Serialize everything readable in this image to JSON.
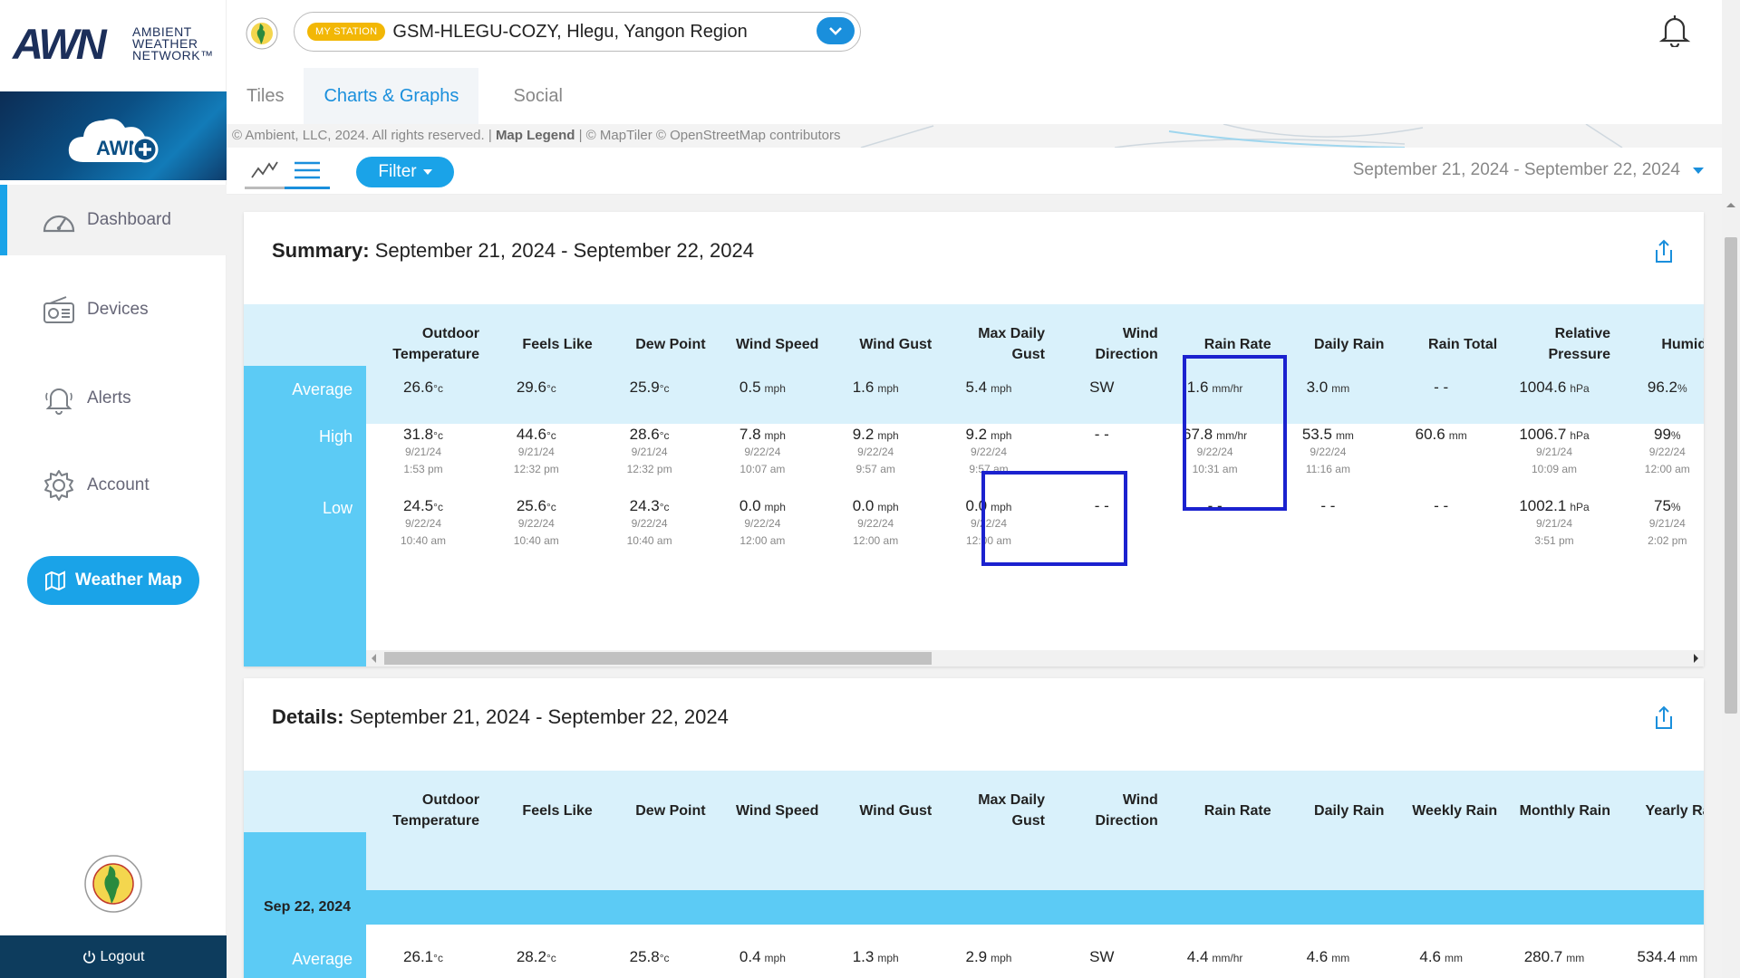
{
  "brand": {
    "mark": "AWN",
    "line1": "AMBIENT",
    "line2": "WEATHER",
    "line3": "NETWORK™"
  },
  "sidebar": {
    "items": [
      {
        "label": "Dashboard",
        "icon": "gauge-icon",
        "active": true
      },
      {
        "label": "Devices",
        "icon": "radio-icon"
      },
      {
        "label": "Alerts",
        "icon": "bell-icon"
      },
      {
        "label": "Account",
        "icon": "gear-icon"
      }
    ],
    "weather_map": "Weather Map",
    "logout": "Logout"
  },
  "station": {
    "badge": "MY STATION",
    "name": "GSM-HLEGU-COZY, Hlegu, Yangon Region"
  },
  "tabs": [
    "Tiles",
    "Charts & Graphs",
    "Social"
  ],
  "map_credit": {
    "prefix": "© Ambient, LLC, 2024. All rights reserved. | ",
    "legend": "Map Legend",
    "suffix": " | © MapTiler © OpenStreetMap contributors"
  },
  "toolbar": {
    "filter": "Filter",
    "date_range": "September 21, 2024 - September 22, 2024"
  },
  "summary": {
    "title_bold": "Summary:",
    "title_rest": " September 21, 2024 - September 22, 2024",
    "columns": [
      [
        "Outdoor",
        "Temperature"
      ],
      [
        "",
        "Feels Like"
      ],
      [
        "",
        "Dew Point"
      ],
      [
        "",
        "Wind Speed"
      ],
      [
        "",
        "Wind Gust"
      ],
      [
        "Max Daily",
        "Gust"
      ],
      [
        "Wind",
        "Direction"
      ],
      [
        "",
        "Rain Rate"
      ],
      [
        "",
        "Daily Rain"
      ],
      [
        "",
        "Rain Total"
      ],
      [
        "Relative",
        "Pressure"
      ],
      [
        "",
        "Humidity"
      ]
    ],
    "rows": [
      {
        "label": "Average",
        "cells": [
          {
            "v": "26.6",
            "u": "°c"
          },
          {
            "v": "29.6",
            "u": "°c"
          },
          {
            "v": "25.9",
            "u": "°c"
          },
          {
            "v": "0.5",
            "u": "mph"
          },
          {
            "v": "1.6",
            "u": "mph"
          },
          {
            "v": "5.4",
            "u": "mph"
          },
          {
            "v": "SW",
            "u": ""
          },
          {
            "v": "1.6",
            "u": "mm/hr"
          },
          {
            "v": "3.0",
            "u": "mm"
          },
          {
            "v": "- -",
            "u": ""
          },
          {
            "v": "1004.6",
            "u": "hPa"
          },
          {
            "v": "96.2",
            "u": "%"
          }
        ]
      },
      {
        "label": "High",
        "cells": [
          {
            "v": "31.8",
            "u": "°c",
            "d": "9/21/24",
            "t": "1:53 pm"
          },
          {
            "v": "44.6",
            "u": "°c",
            "d": "9/21/24",
            "t": "12:32 pm"
          },
          {
            "v": "28.6",
            "u": "°c",
            "d": "9/21/24",
            "t": "12:32 pm"
          },
          {
            "v": "7.8",
            "u": "mph",
            "d": "9/22/24",
            "t": "10:07 am"
          },
          {
            "v": "9.2",
            "u": "mph",
            "d": "9/22/24",
            "t": "9:57 am"
          },
          {
            "v": "9.2",
            "u": "mph",
            "d": "9/22/24",
            "t": "9:57 am"
          },
          {
            "v": "- -",
            "u": ""
          },
          {
            "v": "67.8",
            "u": "mm/hr",
            "d": "9/22/24",
            "t": "10:31 am"
          },
          {
            "v": "53.5",
            "u": "mm",
            "d": "9/22/24",
            "t": "11:16 am"
          },
          {
            "v": "60.6",
            "u": "mm"
          },
          {
            "v": "1006.7",
            "u": "hPa",
            "d": "9/21/24",
            "t": "10:09 am"
          },
          {
            "v": "99",
            "u": "%",
            "d": "9/22/24",
            "t": "12:00 am"
          }
        ]
      },
      {
        "label": "Low",
        "cells": [
          {
            "v": "24.5",
            "u": "°c",
            "d": "9/22/24",
            "t": "10:40 am"
          },
          {
            "v": "25.6",
            "u": "°c",
            "d": "9/22/24",
            "t": "10:40 am"
          },
          {
            "v": "24.3",
            "u": "°c",
            "d": "9/22/24",
            "t": "10:40 am"
          },
          {
            "v": "0.0",
            "u": "mph",
            "d": "9/22/24",
            "t": "12:00 am"
          },
          {
            "v": "0.0",
            "u": "mph",
            "d": "9/22/24",
            "t": "12:00 am"
          },
          {
            "v": "0.0",
            "u": "mph",
            "d": "9/22/24",
            "t": "12:00 am"
          },
          {
            "v": "- -",
            "u": ""
          },
          {
            "v": "- -",
            "u": ""
          },
          {
            "v": "- -",
            "u": ""
          },
          {
            "v": "- -",
            "u": ""
          },
          {
            "v": "1002.1",
            "u": "hPa",
            "d": "9/21/24",
            "t": "3:51 pm"
          },
          {
            "v": "75",
            "u": "%",
            "d": "9/21/24",
            "t": "2:02 pm"
          }
        ]
      }
    ]
  },
  "details": {
    "title_bold": "Details:",
    "title_rest": " September 21, 2024 - September 22, 2024",
    "columns": [
      [
        "Outdoor",
        "Temperature"
      ],
      [
        "",
        "Feels Like"
      ],
      [
        "",
        "Dew Point"
      ],
      [
        "",
        "Wind Speed"
      ],
      [
        "",
        "Wind Gust"
      ],
      [
        "Max Daily",
        "Gust"
      ],
      [
        "Wind",
        "Direction"
      ],
      [
        "",
        "Rain Rate"
      ],
      [
        "",
        "Daily Rain"
      ],
      [
        "",
        "Weekly Rain"
      ],
      [
        "",
        "Monthly Rain"
      ],
      [
        "",
        "Yearly Rain"
      ]
    ],
    "group_label": "Sep 22, 2024",
    "rows": [
      {
        "label": "Average",
        "cells": [
          {
            "v": "26.1",
            "u": "°c"
          },
          {
            "v": "28.2",
            "u": "°c"
          },
          {
            "v": "25.8",
            "u": "°c"
          },
          {
            "v": "0.4",
            "u": "mph"
          },
          {
            "v": "1.3",
            "u": "mph"
          },
          {
            "v": "2.9",
            "u": "mph"
          },
          {
            "v": "SW",
            "u": ""
          },
          {
            "v": "4.4",
            "u": "mm/hr"
          },
          {
            "v": "4.6",
            "u": "mm"
          },
          {
            "v": "4.6",
            "u": "mm"
          },
          {
            "v": "280.7",
            "u": "mm"
          },
          {
            "v": "534.4",
            "u": "mm"
          }
        ]
      }
    ]
  },
  "colors": {
    "accent": "#1aa3e8",
    "header_light": "#d9f1fb",
    "row_label": "#5ccbf5",
    "highlight": "#1b22cf"
  }
}
